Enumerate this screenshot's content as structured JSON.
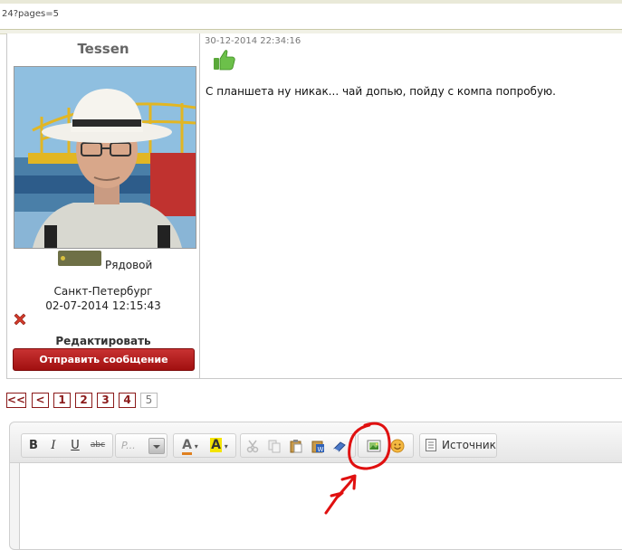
{
  "browser": {
    "url_fragment": "24?pages=5"
  },
  "post": {
    "author": {
      "name": "Tessen",
      "rank": "Рядовой",
      "city": "Санкт-Петербург",
      "registered": "02-07-2014 12:15:43",
      "edit_label": "Редактировать",
      "send_message_label": "Отправить сообщение"
    },
    "timestamp": "30-12-2014 22:34:16",
    "message": "С планшета ну никак... чай допью, пойду с компа попробую.",
    "icons": {
      "like": "thumbs-up-icon",
      "delete": "delete-x-icon"
    }
  },
  "pagination": {
    "first": "<<",
    "prev": "<",
    "pages": [
      "1",
      "2",
      "3",
      "4",
      "5"
    ],
    "current": "5"
  },
  "editor": {
    "toolbar": {
      "bold": "B",
      "italic": "I",
      "underline": "U",
      "strike": "abc",
      "format_placeholder": "P...",
      "text_color": "A",
      "bg_color": "A",
      "source_label": "Источник"
    },
    "content": ""
  },
  "colors": {
    "accent": "#8b1a1a",
    "button": "#b01c1c",
    "annotation": "#e01010"
  }
}
